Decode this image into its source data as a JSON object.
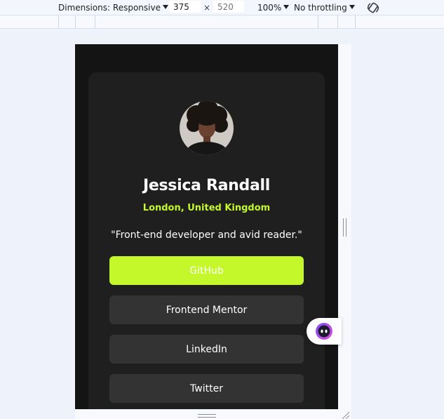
{
  "devtools": {
    "dimensions_label": "Dimensions: Responsive",
    "width_value": "375",
    "height_placeholder": "520",
    "times_sign": "×",
    "zoom_label": "100%",
    "throttling_label": "No throttling"
  },
  "profile": {
    "name": "Jessica Randall",
    "location": "London, United Kingdom",
    "bio": "\"Front-end developer and avid reader.\"",
    "links": [
      "GitHub",
      "Frontend Mentor",
      "LinkedIn",
      "Twitter"
    ]
  },
  "colors": {
    "page_background": "#141414",
    "card_background": "#1f1f1f",
    "accent": "#c4f82a",
    "button_background": "#333333",
    "text": "#ffffff"
  },
  "icons": {
    "rotate": "rotate-icon",
    "extension": "extension-face-icon"
  }
}
